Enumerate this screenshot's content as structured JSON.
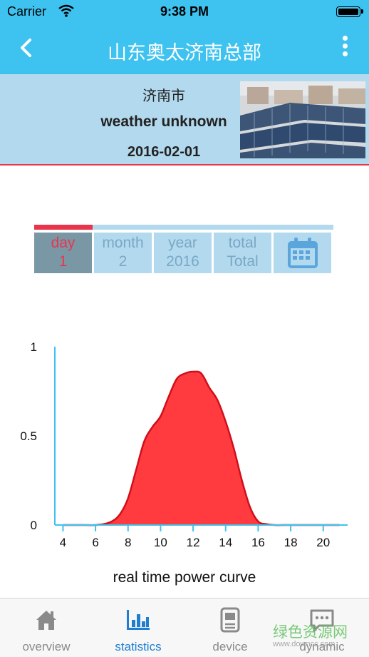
{
  "status": {
    "carrier": "Carrier",
    "time": "9:38 PM"
  },
  "nav": {
    "title": "山东奥太济南总部"
  },
  "weather": {
    "city": "济南市",
    "condition": "weather unknown",
    "date": "2016-02-01"
  },
  "tabs": [
    {
      "top": "day",
      "bottom": "1"
    },
    {
      "top": "month",
      "bottom": "2"
    },
    {
      "top": "year",
      "bottom": "2016"
    },
    {
      "top": "total",
      "bottom": "Total"
    }
  ],
  "chart_data": {
    "type": "area",
    "title": "real time power curve",
    "x": [
      4,
      5,
      6,
      6.5,
      7,
      7.5,
      8,
      8.5,
      9,
      9.5,
      10,
      10.5,
      11,
      11.5,
      12,
      12.5,
      13,
      13.5,
      14,
      14.5,
      15,
      15.5,
      16,
      16.5,
      17,
      18,
      20,
      21
    ],
    "y": [
      0,
      0,
      0,
      0.005,
      0.02,
      0.06,
      0.15,
      0.31,
      0.47,
      0.55,
      0.61,
      0.72,
      0.82,
      0.85,
      0.86,
      0.85,
      0.77,
      0.7,
      0.58,
      0.43,
      0.25,
      0.1,
      0.02,
      0.005,
      0,
      0,
      0,
      0
    ],
    "xticks": [
      4,
      6,
      8,
      10,
      12,
      14,
      16,
      18,
      20
    ],
    "yticks": [
      0,
      0.5,
      1
    ],
    "xlim": [
      3.5,
      21.5
    ],
    "ylim": [
      0,
      1
    ],
    "fill_color": "#ff3b3f",
    "line_color": "#d10f19",
    "axis_color": "#3ec2ef"
  },
  "footer": {
    "items": [
      {
        "label": "overview",
        "icon": "home-icon"
      },
      {
        "label": "statistics",
        "icon": "bar-chart-icon"
      },
      {
        "label": "device",
        "icon": "device-icon"
      },
      {
        "label": "dynamic",
        "icon": "message-icon"
      }
    ]
  },
  "watermark": {
    "text": "绿色资源网",
    "sub": "www.downcc.com"
  },
  "colors": {
    "accent": "#3ec2ef",
    "active_tab": "#e8354b",
    "footer_active": "#1e7fd2"
  }
}
